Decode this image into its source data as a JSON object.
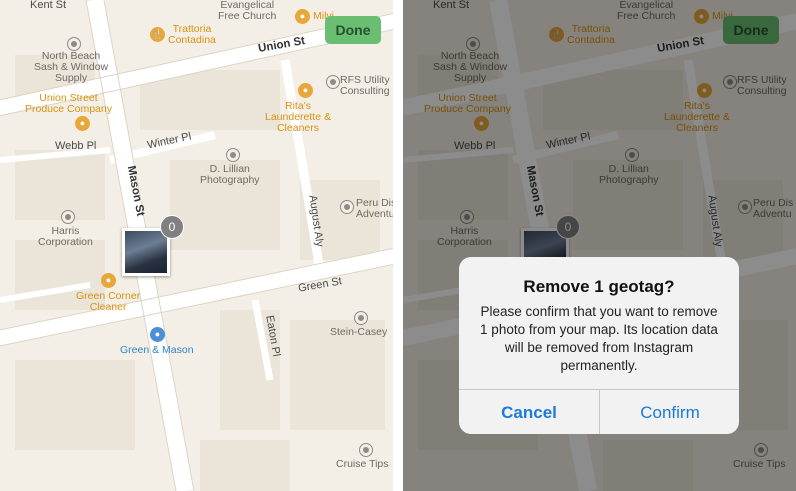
{
  "done_label": "Done",
  "photo_count": "0",
  "map": {
    "streets": {
      "kent": "Kent St",
      "union": "Union St",
      "winter": "Winter Pl",
      "webb": "Webb Pl",
      "mason": "Mason St",
      "august": "August Aly",
      "green": "Green St",
      "eaton": "Eaton Pl"
    },
    "places": {
      "evangelical": "Evangelical\nFree Church",
      "trattoria": "Trattoria\nContadina",
      "milvi": "Milvi",
      "north_beach": "North Beach\nSash & Window\nSupply",
      "rfs": "RFS Utility\nConsulting",
      "union_produce": "Union Street\nProduce Company",
      "ritas": "Rita's\nLaunderette &\nCleaners",
      "dlillian": "D. Lillian\nPhotography",
      "peru": "Peru Dis\nAdventu",
      "harris": "Harris\nCorporation",
      "green_corner": "Green Corner\nCleaner",
      "green_mason": "Green & Mason",
      "stein": "Stein-Casey",
      "cruise": "Cruise Tips"
    }
  },
  "dialog": {
    "title": "Remove 1 geotag?",
    "message": "Please confirm that you want to remove 1 photo from your map. Its location data will be removed from Instagram permanently.",
    "cancel": "Cancel",
    "confirm": "Confirm"
  }
}
